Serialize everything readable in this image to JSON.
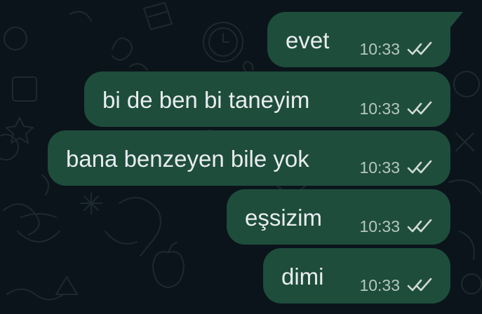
{
  "messages": [
    {
      "text": "evet",
      "time": "10:33",
      "status_icon": "double-check-read-icon"
    },
    {
      "text": "bi de ben bi taneyim",
      "time": "10:33",
      "status_icon": "double-check-read-icon"
    },
    {
      "text": "bana benzeyen bile yok",
      "time": "10:33",
      "status_icon": "double-check-read-icon"
    },
    {
      "text": "eşsizim",
      "time": "10:33",
      "status_icon": "double-check-read-icon"
    },
    {
      "text": "dimi",
      "time": "10:33",
      "status_icon": "double-check-read-icon"
    }
  ],
  "colors": {
    "background": "#0b141a",
    "outgoing_bubble": "#1e4d3b",
    "message_text": "#e9edef",
    "timestamp": "#b7c6c0",
    "ticks": "#d0dbd6"
  }
}
